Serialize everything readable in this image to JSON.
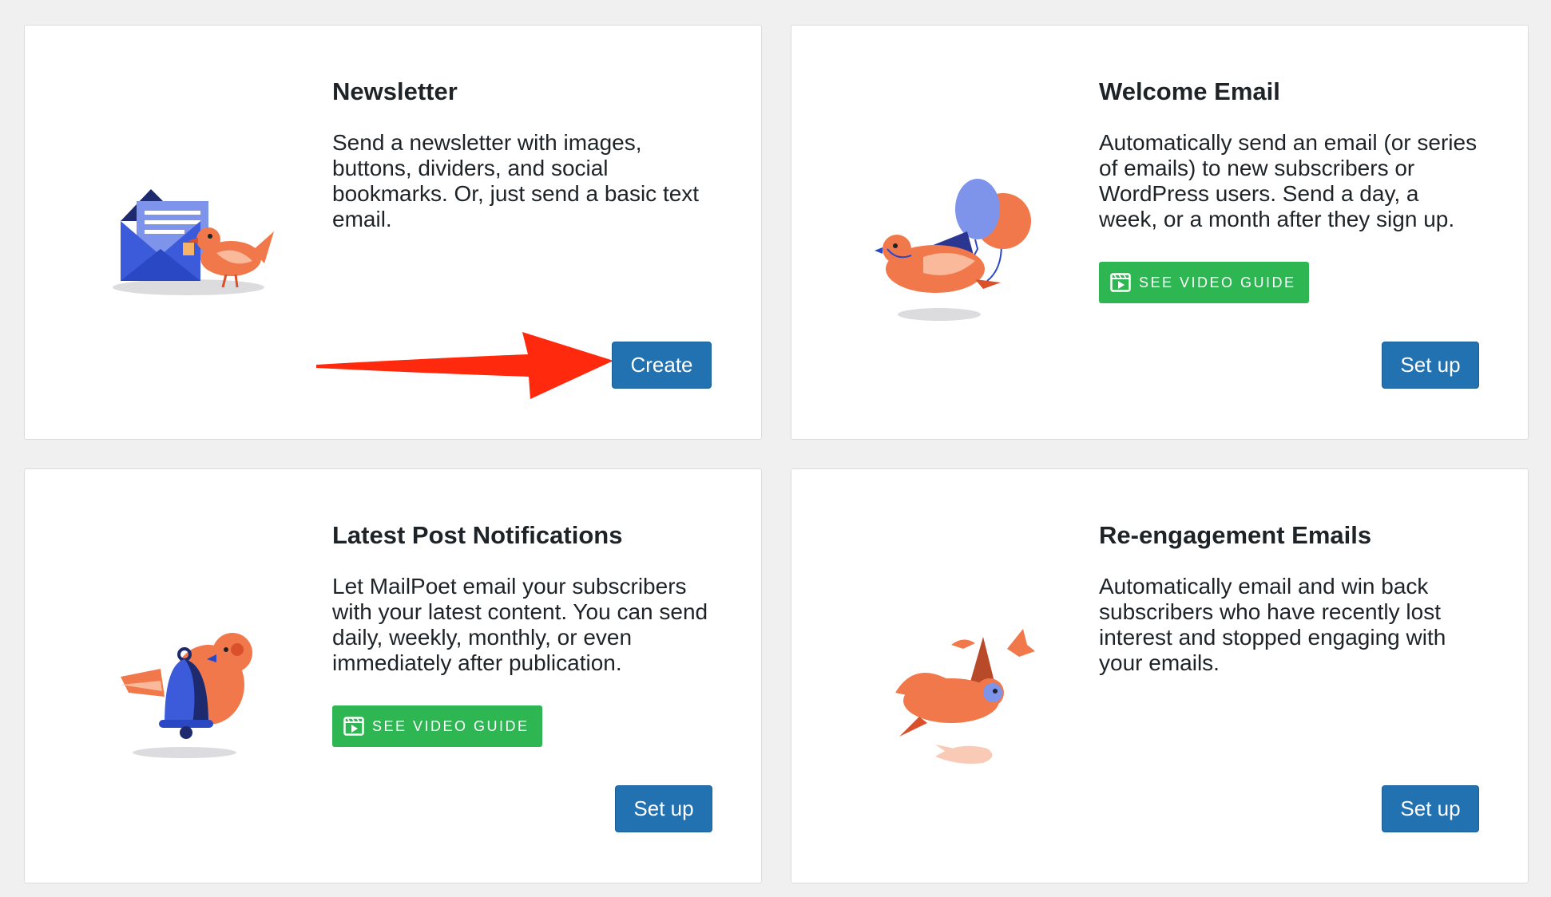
{
  "cards": [
    {
      "title": "Newsletter",
      "description": "Send a newsletter with images, buttons, dividers, and social bookmarks. Or, just send a basic text email.",
      "button_label": "Create",
      "illustration": "envelope-bird-icon"
    },
    {
      "title": "Welcome Email",
      "description": "Automatically send an email (or series of emails) to new subscribers or WordPress users. Send a day, a week, or a month after they sign up.",
      "video_label": "SEE VIDEO GUIDE",
      "button_label": "Set up",
      "illustration": "balloon-bird-icon"
    },
    {
      "title": "Latest Post Notifications",
      "description": "Let MailPoet email your subscribers with your latest content. You can send daily, weekly, monthly, or even immediately after publication.",
      "video_label": "SEE VIDEO GUIDE",
      "button_label": "Set up",
      "illustration": "bell-bird-icon"
    },
    {
      "title": "Re-engagement Emails",
      "description": "Automatically email and win back subscribers who have recently lost interest and stopped engaging with your emails.",
      "button_label": "Set up",
      "illustration": "flying-birds-icon"
    }
  ],
  "colors": {
    "primary_button": "#2271b1",
    "video_button": "#2eb652",
    "annotation_arrow": "#ff2a0e",
    "bird_orange": "#f0784a",
    "accent_blue": "#3b5bdb"
  }
}
